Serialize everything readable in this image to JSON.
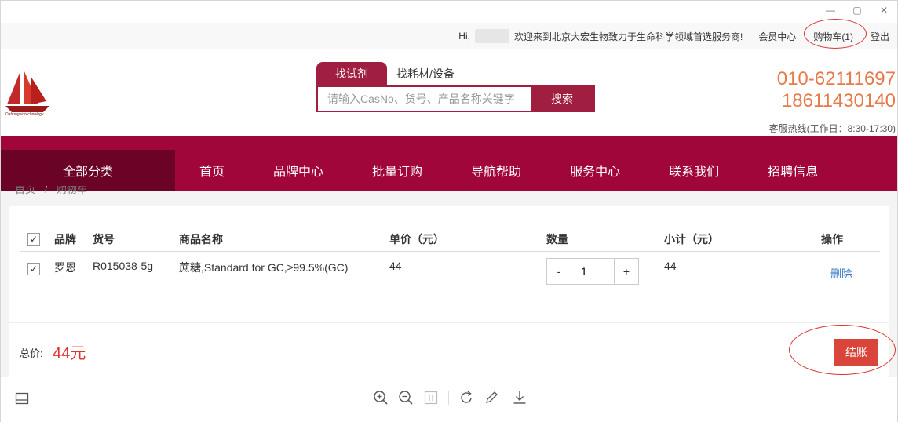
{
  "window": {
    "controls": [
      "minimize",
      "maximize",
      "close"
    ]
  },
  "topbar": {
    "greeting": "Hi,",
    "welcome": "欢迎来到北京大宏生物致力于生命科学领域首选服务商!",
    "member_center": "会员中心",
    "cart": "购物车(1)",
    "logout": "登出"
  },
  "header": {
    "logo_text": "Dahongbiotechnology",
    "search_tabs": [
      "找试剂",
      "找耗材/设备"
    ],
    "search_placeholder": "请输入CasNo、货号、产品名称关键字",
    "search_button": "搜索",
    "phone1": "010-62111697",
    "phone2": "18611430140",
    "hotline": "客服热线(工作日：8:30-17:30)"
  },
  "nav": {
    "all": "全部分类",
    "items": [
      "首页",
      "品牌中心",
      "批量订购",
      "导航帮助",
      "服务中心",
      "联系我们",
      "招聘信息"
    ]
  },
  "breadcrumb": {
    "home": "首页",
    "sep": "/",
    "current": "购物车"
  },
  "cart_table": {
    "headers": {
      "brand": "品牌",
      "code": "货号",
      "name": "商品名称",
      "price": "单价（元）",
      "qty": "数量",
      "subtotal": "小计（元）",
      "op": "操作"
    },
    "rows": [
      {
        "brand": "罗恩",
        "code": "R015038-5g",
        "name": "蔗糖,Standard for GC,≥99.5%(GC)",
        "price": "44",
        "qty": "1",
        "subtotal": "44",
        "delete": "删除",
        "checked": true
      }
    ],
    "qty_minus": "-",
    "qty_plus": "+",
    "check_mark": "✓"
  },
  "summary": {
    "total_label": "总价:",
    "total_value": "44元",
    "checkout": "结账"
  },
  "colors": {
    "brand": "#a0063a",
    "nav_dark": "#6b0326",
    "accent_orange": "#e67a4a",
    "price_red": "#e03030",
    "checkout_red": "#d9453b"
  },
  "toolbar": {
    "icons": [
      "sidebar-icon",
      "zoom-in-icon",
      "zoom-out-icon",
      "fit-page-icon",
      "rotate-icon",
      "pen-icon",
      "download-icon"
    ]
  }
}
